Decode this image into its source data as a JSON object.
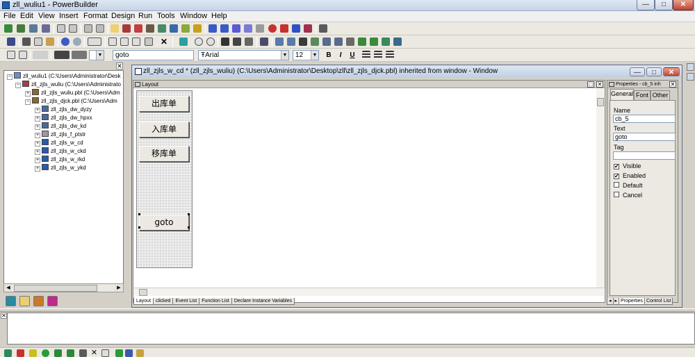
{
  "window": {
    "title": "zll_wuliu1 - PowerBuilder",
    "min_glyph": "—",
    "max_glyph": "□",
    "close_glyph": "✕"
  },
  "menu": [
    "File",
    "Edit",
    "View",
    "Insert",
    "Format",
    "Design",
    "Run",
    "Tools",
    "Window",
    "Help"
  ],
  "format_bar": {
    "name_field_value": "goto",
    "font_name": "Arial",
    "font_prefix": "Ŧ",
    "font_size": "12",
    "bold": "B",
    "italic": "I",
    "underline": "U",
    "combo_arrow": "▼"
  },
  "tree": {
    "close_glyph": "✕",
    "items": [
      {
        "label": "zll_wuliu1 (C:\\Users\\Administrator\\Desk",
        "exp": "−",
        "icon_color": "#6a8fc8"
      },
      {
        "label": "zll_zjls_wuliu (C:\\Users\\Administrato",
        "exp": "−",
        "icon_color": "#b23a3a"
      },
      {
        "label": "zll_zjls_wuliu.pbl (C:\\Users\\Adm",
        "exp": "+",
        "icon_color": "#8a6a2a"
      },
      {
        "label": "zll_zjls_djck.pbl (C:\\Users\\Adm",
        "exp": "−",
        "icon_color": "#8a6a2a"
      },
      {
        "label": "zll_zjls_dw_dyzy",
        "exp": "+",
        "icon_color": "#4a6a9a"
      },
      {
        "label": "zll_zjls_dw_hpxx",
        "exp": "+",
        "icon_color": "#4a6a9a"
      },
      {
        "label": "zll_zjls_dw_kd",
        "exp": "+",
        "icon_color": "#4a6a9a"
      },
      {
        "label": "zll_zjls_f_ptstr",
        "exp": "+",
        "icon_color": "#9a9a9a"
      },
      {
        "label": "zll_zjls_w_cd",
        "exp": "+",
        "icon_color": "#2a5aa8"
      },
      {
        "label": "zll_zjls_w_ckd",
        "exp": "+",
        "icon_color": "#2a5aa8"
      },
      {
        "label": "zll_zjls_w_rkd",
        "exp": "+",
        "icon_color": "#2a5aa8"
      },
      {
        "label": "zll_zjls_w_ykd",
        "exp": "+",
        "icon_color": "#2a5aa8"
      }
    ],
    "scroll_left": "◀",
    "scroll_right": "▶"
  },
  "child_window": {
    "title": "zll_zjls_w_cd * (zll_zjls_wuliu) (C:\\Users\\Administrator\\Desktop\\zll\\zll_zjls_djck.pbl) inherited from window - Window",
    "min_glyph": "—",
    "max_glyph": "□",
    "close_glyph": "✕"
  },
  "layout": {
    "title": "Layout",
    "buttons": [
      "出库单",
      "入库单",
      "移库单",
      "goto"
    ],
    "tabs": [
      "Layout",
      "clicked",
      "Event List",
      "Function List",
      "Declare Instance Variables"
    ],
    "max_glyph": "□",
    "close_glyph": "✕"
  },
  "properties": {
    "title": "Properties - cb_5 inh",
    "tabs": [
      "General",
      "Font",
      "Other"
    ],
    "name_label": "Name",
    "name_value": "cb_5",
    "text_label": "Text",
    "text_value": "goto",
    "tag_label": "Tag",
    "tag_value": "",
    "check_mark": "✔",
    "checks": [
      {
        "label": "Visible",
        "checked": true
      },
      {
        "label": "Enabled",
        "checked": true
      },
      {
        "label": "Default",
        "checked": false
      },
      {
        "label": "Cancel",
        "checked": false
      }
    ],
    "bottom_tabs": [
      "Properties",
      "Control List"
    ],
    "tab_left": "◂",
    "tab_right": "▸",
    "close_glyph": "✕"
  },
  "output": {
    "close_glyph": "✕"
  }
}
